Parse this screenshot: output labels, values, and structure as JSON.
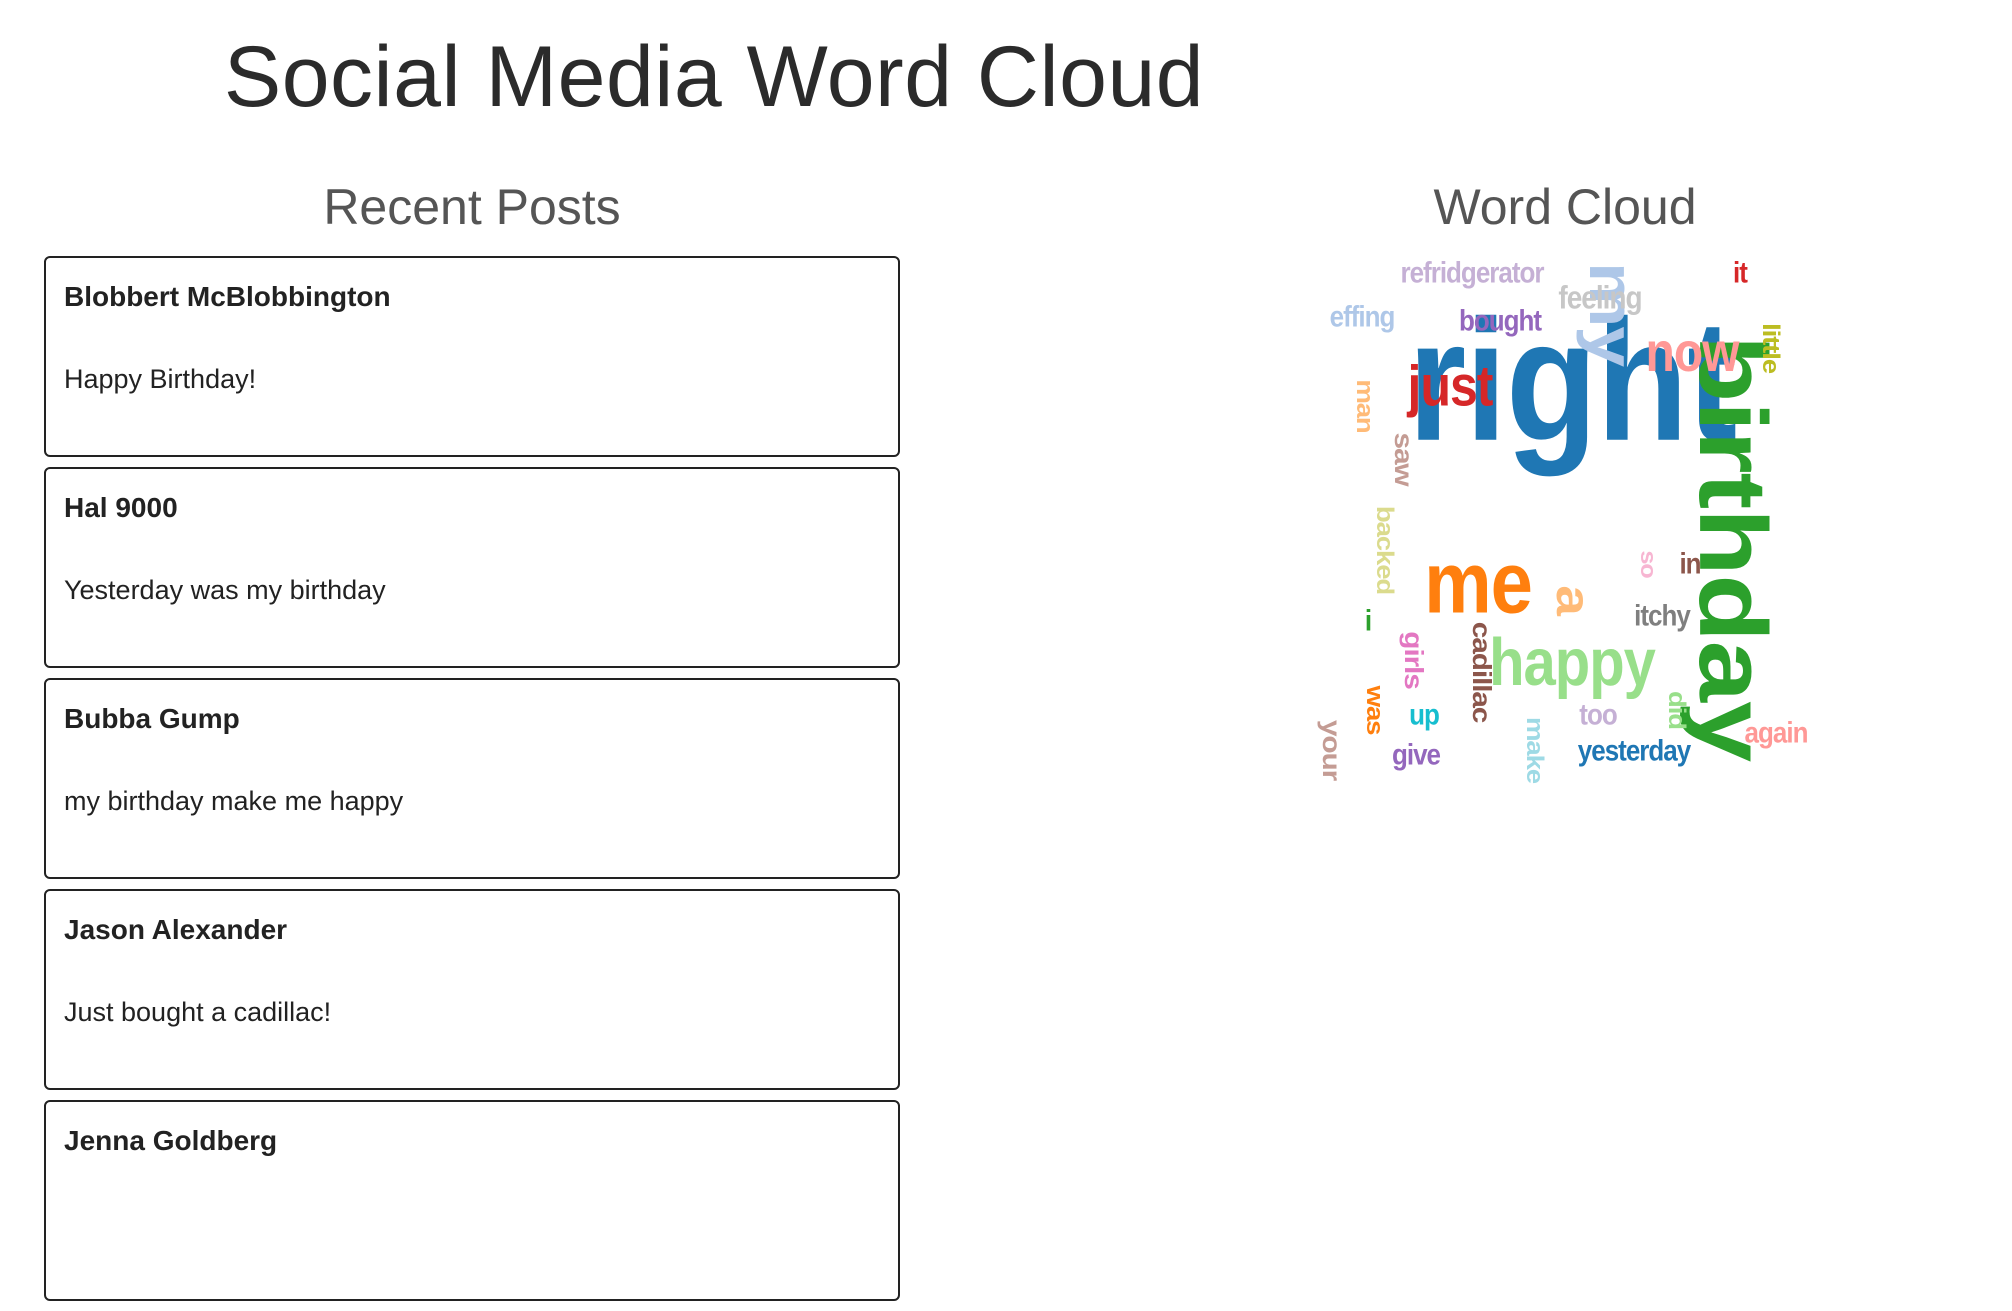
{
  "header": {
    "title": "Social Media Word Cloud"
  },
  "posts_section": {
    "heading": "Recent Posts",
    "posts": [
      {
        "author": "Blobbert McBlobbington",
        "text": "Happy Birthday!"
      },
      {
        "author": "Hal 9000",
        "text": "Yesterday was my birthday"
      },
      {
        "author": "Bubba Gump",
        "text": "my birthday make me happy"
      },
      {
        "author": "Jason Alexander",
        "text": "Just bought a cadillac!"
      },
      {
        "author": "Jenna Goldberg",
        "text": ""
      }
    ]
  },
  "cloud_section": {
    "heading": "Word Cloud",
    "words": [
      {
        "text": "right",
        "color": "#1f77b4",
        "vertical": false
      },
      {
        "text": "birthday",
        "color": "#2ca02c",
        "vertical": true
      },
      {
        "text": "me",
        "color": "#ff7f0e",
        "vertical": false
      },
      {
        "text": "my",
        "color": "#aec7e8",
        "vertical": true
      },
      {
        "text": "happy",
        "color": "#98df8a",
        "vertical": false
      },
      {
        "text": "just",
        "color": "#d62728",
        "vertical": false
      },
      {
        "text": "now",
        "color": "#ff9896",
        "vertical": false
      },
      {
        "text": "a",
        "color": "#ffbb78",
        "vertical": true
      },
      {
        "text": "refridgerator",
        "color": "#c5b0d5",
        "vertical": false
      },
      {
        "text": "feeling",
        "color": "#c7c7c7",
        "vertical": false
      },
      {
        "text": "it",
        "color": "#d62728",
        "vertical": false
      },
      {
        "text": "effing",
        "color": "#aec7e8",
        "vertical": false
      },
      {
        "text": "bought",
        "color": "#9467bd",
        "vertical": false
      },
      {
        "text": "little",
        "color": "#bcbd22",
        "vertical": true
      },
      {
        "text": "man",
        "color": "#ffbb78",
        "vertical": true
      },
      {
        "text": "saw",
        "color": "#c49c94",
        "vertical": true
      },
      {
        "text": "backed",
        "color": "#dbdb8d",
        "vertical": true
      },
      {
        "text": "so",
        "color": "#f7b6d2",
        "vertical": true
      },
      {
        "text": "in",
        "color": "#8c564b",
        "vertical": false
      },
      {
        "text": "itchy",
        "color": "#7f7f7f",
        "vertical": false
      },
      {
        "text": "i",
        "color": "#2ca02c",
        "vertical": false
      },
      {
        "text": "girls",
        "color": "#e377c2",
        "vertical": true
      },
      {
        "text": "cadillac",
        "color": "#8c564b",
        "vertical": true
      },
      {
        "text": "was",
        "color": "#ff7f0e",
        "vertical": true
      },
      {
        "text": "up",
        "color": "#17becf",
        "vertical": false
      },
      {
        "text": "too",
        "color": "#c5b0d5",
        "vertical": false
      },
      {
        "text": "did",
        "color": "#98df8a",
        "vertical": true
      },
      {
        "text": "again",
        "color": "#ff9896",
        "vertical": false
      },
      {
        "text": "your",
        "color": "#c49c94",
        "vertical": true
      },
      {
        "text": "give",
        "color": "#9467bd",
        "vertical": false
      },
      {
        "text": "make",
        "color": "#9edae5",
        "vertical": true
      },
      {
        "text": "yesterday",
        "color": "#1f77b4",
        "vertical": false
      }
    ]
  }
}
